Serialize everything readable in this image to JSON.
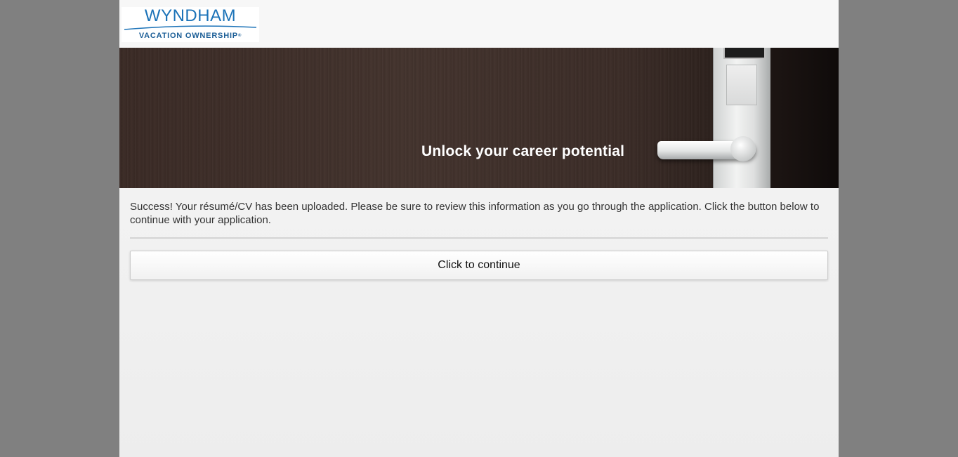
{
  "header": {
    "logo": {
      "brand": "WYNDHAM",
      "subtitle": "VACATION OWNERSHIP",
      "trademark": "®"
    }
  },
  "banner": {
    "tagline": "Unlock your career potential"
  },
  "main": {
    "message": "Success! Your résumé/CV has been uploaded. Please be sure to review this information as you go through the application. Click the button below to continue with your application.",
    "continue_label": "Click to continue"
  },
  "colors": {
    "outer_background": "#808080",
    "brand_blue": "#1c73b8",
    "page_background": "#f2f2f2"
  }
}
